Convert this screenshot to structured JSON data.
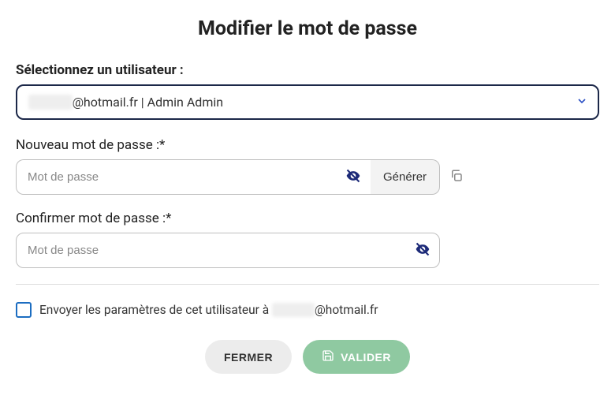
{
  "title": "Modifier le mot de passe",
  "user_label": "Sélectionnez un utilisateur :",
  "user_select": {
    "redacted": "xxxxxxx",
    "rest": "@hotmail.fr | Admin Admin"
  },
  "new_pw_label": "Nouveau mot de passe :*",
  "new_pw_placeholder": "Mot de passe",
  "generate_label": "Générer",
  "confirm_pw_label": "Confirmer mot de passe :*",
  "confirm_pw_placeholder": "Mot de passe",
  "send_params_prefix": "Envoyer les paramètres de cet utilisateur à ",
  "send_params_redacted": "xxxxxxx",
  "send_params_suffix": "@hotmail.fr",
  "close_label": "Fermer",
  "submit_label": "Valider"
}
